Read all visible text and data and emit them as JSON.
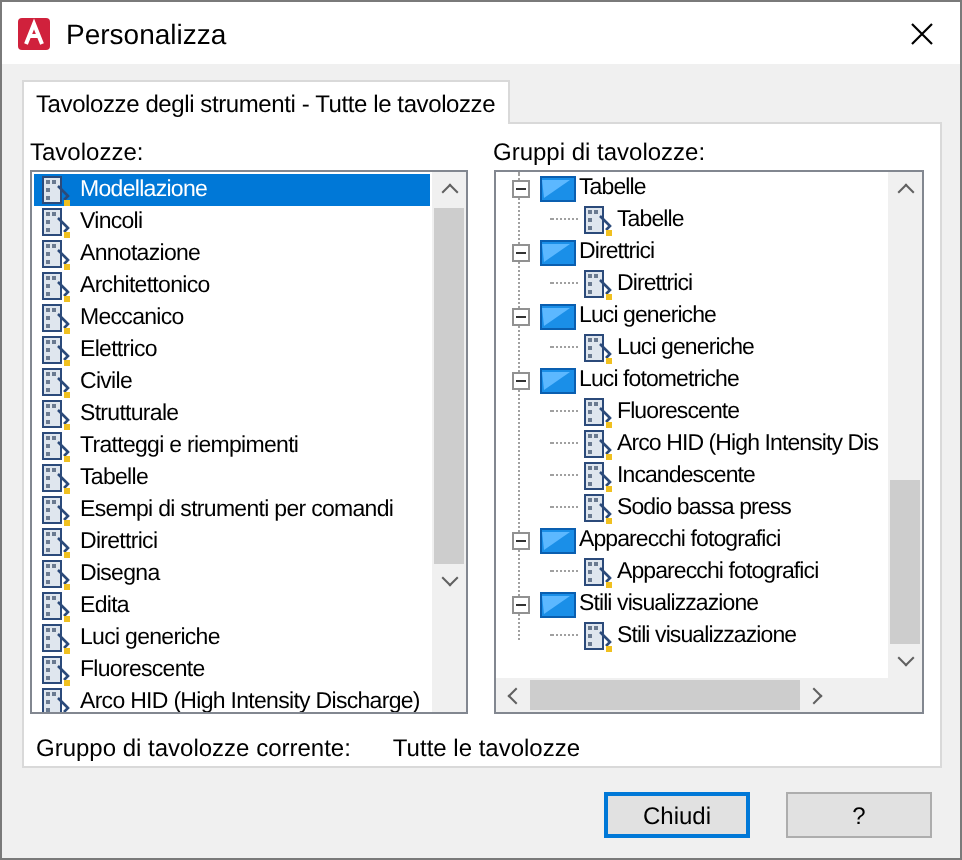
{
  "window": {
    "title": "Personalizza"
  },
  "tabs": [
    {
      "label": "Tavolozze degli strumenti - Tutte le tavolozze",
      "selected": true
    }
  ],
  "palettes": {
    "label": "Tavolozze:",
    "items": [
      {
        "label": "Modellazione",
        "selected": true
      },
      {
        "label": "Vincoli",
        "selected": false
      },
      {
        "label": "Annotazione",
        "selected": false
      },
      {
        "label": "Architettonico",
        "selected": false
      },
      {
        "label": "Meccanico",
        "selected": false
      },
      {
        "label": "Elettrico",
        "selected": false
      },
      {
        "label": "Civile",
        "selected": false
      },
      {
        "label": "Strutturale",
        "selected": false
      },
      {
        "label": "Tratteggi e riempimenti",
        "selected": false
      },
      {
        "label": "Tabelle",
        "selected": false
      },
      {
        "label": "Esempi di strumenti per comandi",
        "selected": false
      },
      {
        "label": "Direttrici",
        "selected": false
      },
      {
        "label": "Disegna",
        "selected": false
      },
      {
        "label": "Edita",
        "selected": false
      },
      {
        "label": "Luci generiche",
        "selected": false
      },
      {
        "label": "Fluorescente",
        "selected": false
      },
      {
        "label": "Arco HID (High Intensity Discharge)",
        "selected": false
      }
    ]
  },
  "groups": {
    "label": "Gruppi di tavolozze:",
    "tree": [
      {
        "label": "Tabelle",
        "kind": "group",
        "expanded": true,
        "children": [
          {
            "label": "Tabelle",
            "kind": "palette"
          }
        ]
      },
      {
        "label": "Direttrici",
        "kind": "group",
        "expanded": true,
        "children": [
          {
            "label": "Direttrici",
            "kind": "palette"
          }
        ]
      },
      {
        "label": "Luci generiche",
        "kind": "group",
        "expanded": true,
        "children": [
          {
            "label": "Luci generiche",
            "kind": "palette"
          }
        ]
      },
      {
        "label": "Luci fotometriche",
        "kind": "group",
        "expanded": true,
        "children": [
          {
            "label": "Fluorescente",
            "kind": "palette"
          },
          {
            "label": "Arco HID (High Intensity Dis",
            "kind": "palette"
          },
          {
            "label": "Incandescente",
            "kind": "palette"
          },
          {
            "label": "Sodio bassa press",
            "kind": "palette"
          }
        ]
      },
      {
        "label": "Apparecchi fotografici",
        "kind": "group",
        "expanded": true,
        "children": [
          {
            "label": "Apparecchi fotografici",
            "kind": "palette"
          }
        ]
      },
      {
        "label": "Stili visualizzazione",
        "kind": "group",
        "expanded": true,
        "children": [
          {
            "label": "Stili visualizzazione",
            "kind": "palette"
          }
        ]
      }
    ]
  },
  "current_group": {
    "label": "Gruppo di tavolozze corrente:",
    "value": "Tutte le tavolozze"
  },
  "buttons": [
    {
      "label": "Chiudi",
      "default": true
    },
    {
      "label": "?",
      "default": false
    }
  ]
}
